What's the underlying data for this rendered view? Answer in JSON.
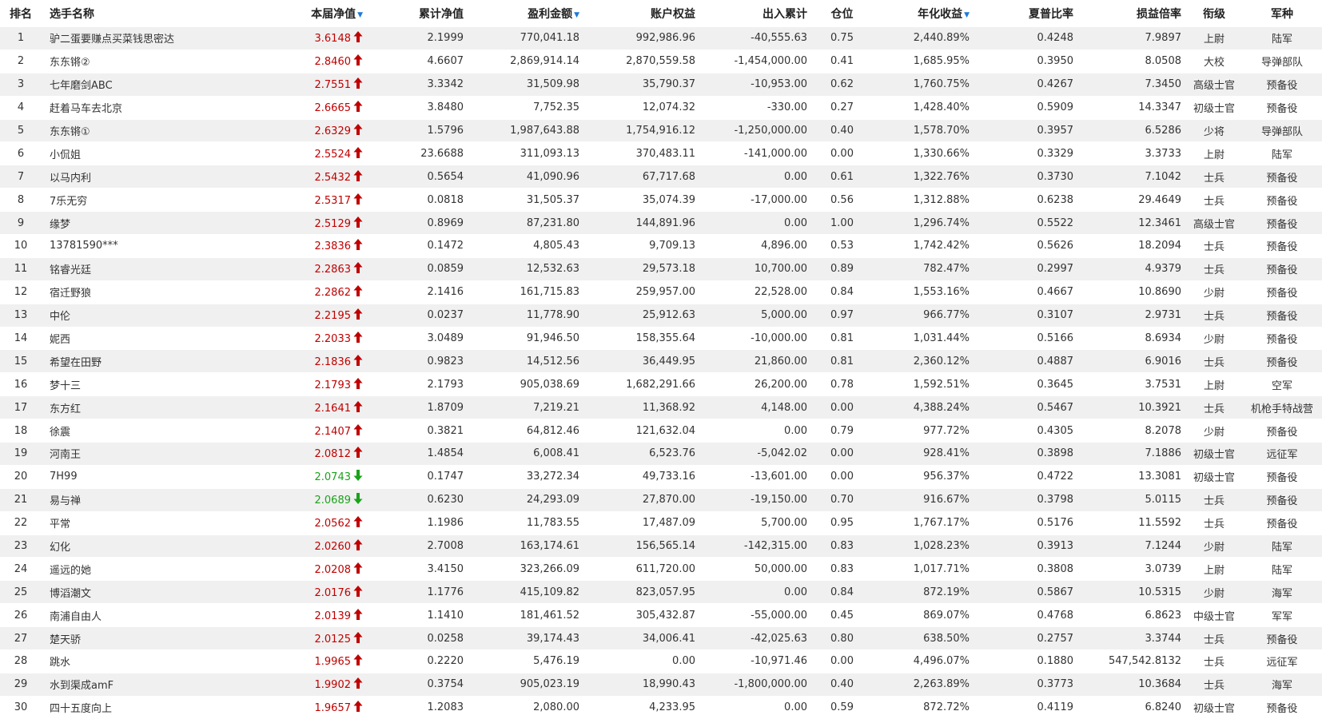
{
  "colors": {
    "up": "#c00000",
    "down": "#1aa31a",
    "sort": "#1f7ad6",
    "stripe": "#f0f0f0"
  },
  "headers": {
    "rank": "排名",
    "name": "选手名称",
    "nav": "本届净值",
    "cum_nav": "累计净值",
    "profit": "盈利金额",
    "equity": "账户权益",
    "inout": "出入累计",
    "position": "仓位",
    "annual": "年化收益",
    "sharpe": "夏普比率",
    "pl_ratio": "损益倍率",
    "rank_title": "衔级",
    "army": "军种"
  },
  "sort_icon": "sort-down-icon",
  "rows": [
    {
      "rank": "1",
      "name": "驴二蛋要赚点买菜钱思密达",
      "nav": "3.6148",
      "dir": "up",
      "cum": "2.1999",
      "profit": "770,041.18",
      "equity": "992,986.96",
      "inout": "-40,555.63",
      "pos": "0.75",
      "annual": "2,440.89%",
      "sharpe": "0.4248",
      "plr": "7.9897",
      "title": "上尉",
      "army": "陆军"
    },
    {
      "rank": "2",
      "name": "东东锵②",
      "nav": "2.8460",
      "dir": "up",
      "cum": "4.6607",
      "profit": "2,869,914.14",
      "equity": "2,870,559.58",
      "inout": "-1,454,000.00",
      "pos": "0.41",
      "annual": "1,685.95%",
      "sharpe": "0.3950",
      "plr": "8.0508",
      "title": "大校",
      "army": "导弹部队"
    },
    {
      "rank": "3",
      "name": "七年磨剑ABC",
      "nav": "2.7551",
      "dir": "up",
      "cum": "3.3342",
      "profit": "31,509.98",
      "equity": "35,790.37",
      "inout": "-10,953.00",
      "pos": "0.62",
      "annual": "1,760.75%",
      "sharpe": "0.4267",
      "plr": "7.3450",
      "title": "高级士官",
      "army": "预备役"
    },
    {
      "rank": "4",
      "name": "赶着马车去北京",
      "nav": "2.6665",
      "dir": "up",
      "cum": "3.8480",
      "profit": "7,752.35",
      "equity": "12,074.32",
      "inout": "-330.00",
      "pos": "0.27",
      "annual": "1,428.40%",
      "sharpe": "0.5909",
      "plr": "14.3347",
      "title": "初级士官",
      "army": "预备役"
    },
    {
      "rank": "5",
      "name": "东东锵①",
      "nav": "2.6329",
      "dir": "up",
      "cum": "1.5796",
      "profit": "1,987,643.88",
      "equity": "1,754,916.12",
      "inout": "-1,250,000.00",
      "pos": "0.40",
      "annual": "1,578.70%",
      "sharpe": "0.3957",
      "plr": "6.5286",
      "title": "少将",
      "army": "导弹部队"
    },
    {
      "rank": "6",
      "name": "小侃姐",
      "nav": "2.5524",
      "dir": "up",
      "cum": "23.6688",
      "profit": "311,093.13",
      "equity": "370,483.11",
      "inout": "-141,000.00",
      "pos": "0.00",
      "annual": "1,330.66%",
      "sharpe": "0.3329",
      "plr": "3.3733",
      "title": "上尉",
      "army": "陆军"
    },
    {
      "rank": "7",
      "name": "以马内利",
      "nav": "2.5432",
      "dir": "up",
      "cum": "0.5654",
      "profit": "41,090.96",
      "equity": "67,717.68",
      "inout": "0.00",
      "pos": "0.61",
      "annual": "1,322.76%",
      "sharpe": "0.3730",
      "plr": "7.1042",
      "title": "士兵",
      "army": "预备役"
    },
    {
      "rank": "8",
      "name": "7乐无穷",
      "nav": "2.5317",
      "dir": "up",
      "cum": "0.0818",
      "profit": "31,505.37",
      "equity": "35,074.39",
      "inout": "-17,000.00",
      "pos": "0.56",
      "annual": "1,312.88%",
      "sharpe": "0.6238",
      "plr": "29.4649",
      "title": "士兵",
      "army": "预备役"
    },
    {
      "rank": "9",
      "name": "缘梦",
      "nav": "2.5129",
      "dir": "up",
      "cum": "0.8969",
      "profit": "87,231.80",
      "equity": "144,891.96",
      "inout": "0.00",
      "pos": "1.00",
      "annual": "1,296.74%",
      "sharpe": "0.5522",
      "plr": "12.3461",
      "title": "高级士官",
      "army": "预备役"
    },
    {
      "rank": "10",
      "name": "13781590***",
      "nav": "2.3836",
      "dir": "up",
      "cum": "0.1472",
      "profit": "4,805.43",
      "equity": "9,709.13",
      "inout": "4,896.00",
      "pos": "0.53",
      "annual": "1,742.42%",
      "sharpe": "0.5626",
      "plr": "18.2094",
      "title": "士兵",
      "army": "预备役"
    },
    {
      "rank": "11",
      "name": "铭睿光廷",
      "nav": "2.2863",
      "dir": "up",
      "cum": "0.0859",
      "profit": "12,532.63",
      "equity": "29,573.18",
      "inout": "10,700.00",
      "pos": "0.89",
      "annual": "782.47%",
      "sharpe": "0.2997",
      "plr": "4.9379",
      "title": "士兵",
      "army": "预备役"
    },
    {
      "rank": "12",
      "name": "宿迁野狼",
      "nav": "2.2862",
      "dir": "up",
      "cum": "2.1416",
      "profit": "161,715.83",
      "equity": "259,957.00",
      "inout": "22,528.00",
      "pos": "0.84",
      "annual": "1,553.16%",
      "sharpe": "0.4667",
      "plr": "10.8690",
      "title": "少尉",
      "army": "预备役"
    },
    {
      "rank": "13",
      "name": "中伦",
      "nav": "2.2195",
      "dir": "up",
      "cum": "0.0237",
      "profit": "11,778.90",
      "equity": "25,912.63",
      "inout": "5,000.00",
      "pos": "0.97",
      "annual": "966.77%",
      "sharpe": "0.3107",
      "plr": "2.9731",
      "title": "士兵",
      "army": "预备役"
    },
    {
      "rank": "14",
      "name": "妮西",
      "nav": "2.2033",
      "dir": "up",
      "cum": "3.0489",
      "profit": "91,946.50",
      "equity": "158,355.64",
      "inout": "-10,000.00",
      "pos": "0.81",
      "annual": "1,031.44%",
      "sharpe": "0.5166",
      "plr": "8.6934",
      "title": "少尉",
      "army": "预备役"
    },
    {
      "rank": "15",
      "name": "希望在田野",
      "nav": "2.1836",
      "dir": "up",
      "cum": "0.9823",
      "profit": "14,512.56",
      "equity": "36,449.95",
      "inout": "21,860.00",
      "pos": "0.81",
      "annual": "2,360.12%",
      "sharpe": "0.4887",
      "plr": "6.9016",
      "title": "士兵",
      "army": "预备役"
    },
    {
      "rank": "16",
      "name": "梦十三",
      "nav": "2.1793",
      "dir": "up",
      "cum": "2.1793",
      "profit": "905,038.69",
      "equity": "1,682,291.66",
      "inout": "26,200.00",
      "pos": "0.78",
      "annual": "1,592.51%",
      "sharpe": "0.3645",
      "plr": "3.7531",
      "title": "上尉",
      "army": "空军"
    },
    {
      "rank": "17",
      "name": "东方红",
      "nav": "2.1641",
      "dir": "up",
      "cum": "1.8709",
      "profit": "7,219.21",
      "equity": "11,368.92",
      "inout": "4,148.00",
      "pos": "0.00",
      "annual": "4,388.24%",
      "sharpe": "0.5467",
      "plr": "10.3921",
      "title": "士兵",
      "army": "机枪手特战营"
    },
    {
      "rank": "18",
      "name": "徐震",
      "nav": "2.1407",
      "dir": "up",
      "cum": "0.3821",
      "profit": "64,812.46",
      "equity": "121,632.04",
      "inout": "0.00",
      "pos": "0.79",
      "annual": "977.72%",
      "sharpe": "0.4305",
      "plr": "8.2078",
      "title": "少尉",
      "army": "预备役"
    },
    {
      "rank": "19",
      "name": "河南王",
      "nav": "2.0812",
      "dir": "up",
      "cum": "1.4854",
      "profit": "6,008.41",
      "equity": "6,523.76",
      "inout": "-5,042.02",
      "pos": "0.00",
      "annual": "928.41%",
      "sharpe": "0.3898",
      "plr": "7.1886",
      "title": "初级士官",
      "army": "远征军"
    },
    {
      "rank": "20",
      "name": "7H99",
      "nav": "2.0743",
      "dir": "down",
      "cum": "0.1747",
      "profit": "33,272.34",
      "equity": "49,733.16",
      "inout": "-13,601.00",
      "pos": "0.00",
      "annual": "956.37%",
      "sharpe": "0.4722",
      "plr": "13.3081",
      "title": "初级士官",
      "army": "预备役"
    },
    {
      "rank": "21",
      "name": "易与禅",
      "nav": "2.0689",
      "dir": "down",
      "cum": "0.6230",
      "profit": "24,293.09",
      "equity": "27,870.00",
      "inout": "-19,150.00",
      "pos": "0.70",
      "annual": "916.67%",
      "sharpe": "0.3798",
      "plr": "5.0115",
      "title": "士兵",
      "army": "预备役"
    },
    {
      "rank": "22",
      "name": "平常",
      "nav": "2.0562",
      "dir": "up",
      "cum": "1.1986",
      "profit": "11,783.55",
      "equity": "17,487.09",
      "inout": "5,700.00",
      "pos": "0.95",
      "annual": "1,767.17%",
      "sharpe": "0.5176",
      "plr": "11.5592",
      "title": "士兵",
      "army": "预备役"
    },
    {
      "rank": "23",
      "name": "幻化",
      "nav": "2.0260",
      "dir": "up",
      "cum": "2.7008",
      "profit": "163,174.61",
      "equity": "156,565.14",
      "inout": "-142,315.00",
      "pos": "0.83",
      "annual": "1,028.23%",
      "sharpe": "0.3913",
      "plr": "7.1244",
      "title": "少尉",
      "army": "陆军"
    },
    {
      "rank": "24",
      "name": "遥远的她",
      "nav": "2.0208",
      "dir": "up",
      "cum": "3.4150",
      "profit": "323,266.09",
      "equity": "611,720.00",
      "inout": "50,000.00",
      "pos": "0.83",
      "annual": "1,017.71%",
      "sharpe": "0.3808",
      "plr": "3.0739",
      "title": "上尉",
      "army": "陆军"
    },
    {
      "rank": "25",
      "name": "博滔潮文",
      "nav": "2.0176",
      "dir": "up",
      "cum": "1.1776",
      "profit": "415,109.82",
      "equity": "823,057.95",
      "inout": "0.00",
      "pos": "0.84",
      "annual": "872.19%",
      "sharpe": "0.5867",
      "plr": "10.5315",
      "title": "少尉",
      "army": "海军"
    },
    {
      "rank": "26",
      "name": "南浦自由人",
      "nav": "2.0139",
      "dir": "up",
      "cum": "1.1410",
      "profit": "181,461.52",
      "equity": "305,432.87",
      "inout": "-55,000.00",
      "pos": "0.45",
      "annual": "869.07%",
      "sharpe": "0.4768",
      "plr": "6.8623",
      "title": "中级士官",
      "army": "军军"
    },
    {
      "rank": "27",
      "name": "楚天骄",
      "nav": "2.0125",
      "dir": "up",
      "cum": "0.0258",
      "profit": "39,174.43",
      "equity": "34,006.41",
      "inout": "-42,025.63",
      "pos": "0.80",
      "annual": "638.50%",
      "sharpe": "0.2757",
      "plr": "3.3744",
      "title": "士兵",
      "army": "预备役"
    },
    {
      "rank": "28",
      "name": "跳水",
      "nav": "1.9965",
      "dir": "up",
      "cum": "0.2220",
      "profit": "5,476.19",
      "equity": "0.00",
      "inout": "-10,971.46",
      "pos": "0.00",
      "annual": "4,496.07%",
      "sharpe": "0.1880",
      "plr": "547,542.8132",
      "title": "士兵",
      "army": "远征军"
    },
    {
      "rank": "29",
      "name": "水到渠成amF",
      "nav": "1.9902",
      "dir": "up",
      "cum": "0.3754",
      "profit": "905,023.19",
      "equity": "18,990.43",
      "inout": "-1,800,000.00",
      "pos": "0.40",
      "annual": "2,263.89%",
      "sharpe": "0.3773",
      "plr": "10.3684",
      "title": "士兵",
      "army": "海军"
    },
    {
      "rank": "30",
      "name": "四十五度向上",
      "nav": "1.9657",
      "dir": "up",
      "cum": "1.2083",
      "profit": "2,080.00",
      "equity": "4,233.95",
      "inout": "0.00",
      "pos": "0.59",
      "annual": "872.72%",
      "sharpe": "0.4119",
      "plr": "6.8240",
      "title": "初级士官",
      "army": "预备役"
    }
  ]
}
